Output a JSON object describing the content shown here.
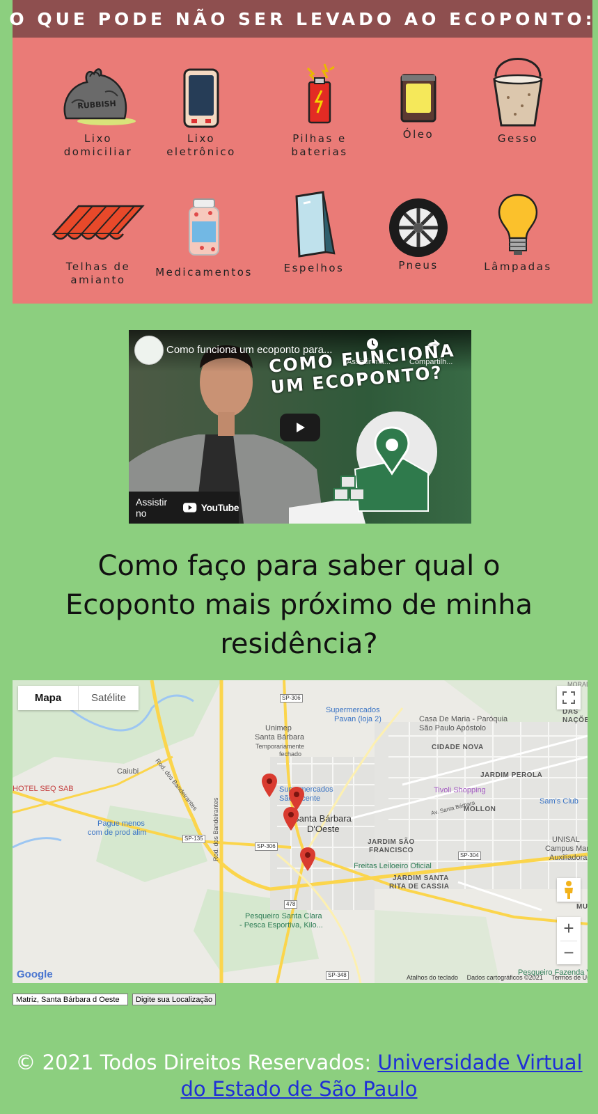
{
  "infographic": {
    "title": "O QUE PODE NÃO SER LEVADO AO ECOPONTO:",
    "items": [
      {
        "icon": "trash-bag-icon",
        "line1": "Lixo",
        "line2": "domiciliar",
        "bag_text": "RUBBISH"
      },
      {
        "icon": "phone-icon",
        "line1": "Lixo",
        "line2": "eletrônico"
      },
      {
        "icon": "battery-icon",
        "line1": "Pilhas e",
        "line2": "baterias"
      },
      {
        "icon": "oil-can-icon",
        "line1": "Óleo",
        "line2": ""
      },
      {
        "icon": "plaster-bucket-icon",
        "line1": "Gesso",
        "line2": ""
      },
      {
        "icon": "roof-tiles-icon",
        "line1": "Telhas de",
        "line2": "amianto"
      },
      {
        "icon": "medicine-bottle-icon",
        "line1": "Medicamentos",
        "line2": ""
      },
      {
        "icon": "mirror-icon",
        "line1": "Espelhos",
        "line2": ""
      },
      {
        "icon": "tire-icon",
        "line1": "Pneus",
        "line2": ""
      },
      {
        "icon": "light-bulb-icon",
        "line1": "Lâmpadas",
        "line2": ""
      }
    ]
  },
  "video": {
    "title": "Como funciona um ecoponto para...",
    "watch_later": "Assistir ma...",
    "share": "Compartilh...",
    "headline_line1": "COMO FUNCIONA",
    "headline_line2": "UM ECOPONTO?",
    "watch_on": "Assistir no",
    "youtube": "YouTube"
  },
  "heading": {
    "line1": "Como faço para saber qual o",
    "line2": "Ecoponto mais próximo de minha",
    "line3": "residência?"
  },
  "map": {
    "type_map": "Mapa",
    "type_satellite": "Satélite",
    "labels": {
      "pavan": "Supermercados",
      "pavan2": "Pavan (loja 2)",
      "casa_maria": "Casa De Maria - Paróquia",
      "casa_maria2": "São Paulo Apóstolo",
      "unimep": "Unimep",
      "unimep2": "Santa Bárbara",
      "unimep3": "Temporariamente",
      "unimep4": "fechado",
      "cidade_nova": "CIDADE NOVA",
      "caiubi": "Caiubi",
      "hotel": "HOTEL SEQ SAB",
      "jardim_perola": "JARDIM PEROLA",
      "tivoli": "Tivoli Shopping",
      "molon": "MOLLON",
      "sams": "Sam's Club",
      "supermercados_sv": "Supermercados",
      "sao_vicente": "São Vicente",
      "santa_barbara": "Santa Bárbara",
      "doeste": "D'Oeste",
      "pague_menos": "Pague menos",
      "pague_menos2": "com de prod alim",
      "jardim_sf": "JARDIM SÃO",
      "jardim_sf2": "FRANCISCO",
      "freitas": "Freitas Leiloeiro Oficial",
      "jardim_src": "JARDIM SANTA",
      "jardim_src2": "RITA DE CASSIA",
      "unisal": "UNISAL",
      "unisal2": "Campus Maria",
      "unisal3": "Auxiliadora",
      "pesqueiro": "Pesqueiro Santa Clara",
      "pesqueiro2": "- Pesca Esportiva, Kilo...",
      "pesqueiro_fazenda": "Pesqueiro Fazenda V",
      "rod_bandeirantes": "Rod. dos Bandeirantes",
      "rod_bandeirantes2": "Rod. dos Bandeirantes",
      "av_santa_barbara": "Av. Santa Bárbara",
      "sp306a": "SP-306",
      "sp306b": "SP-306",
      "sp135": "SP-135",
      "sp304": "SP-304",
      "sp348": "SP-348",
      "r478": "478",
      "morada": "MORADA DO",
      "nacoes": "PA... DAS NAÇÕES",
      "mun": "MUN",
      "google": "Google",
      "atalhos": "Atalhos do teclado",
      "dados": "Dados cartográficos ©2021",
      "termos": "Termos de Uso"
    }
  },
  "controls": {
    "location_value": "Matriz, Santa Bárbara d Oeste",
    "locate_button": "Digite sua Localização"
  },
  "footer": {
    "prefix": "© 2021 Todos Direitos Reservados: ",
    "link": "Universidade Virtual do Estado de São Paulo"
  },
  "colors": {
    "page_bg": "#8ccf7f",
    "panel_bg": "#ea7b77",
    "panel_header": "#8e4f4f",
    "link": "#1f2fd6",
    "pin": "#d93b30"
  }
}
